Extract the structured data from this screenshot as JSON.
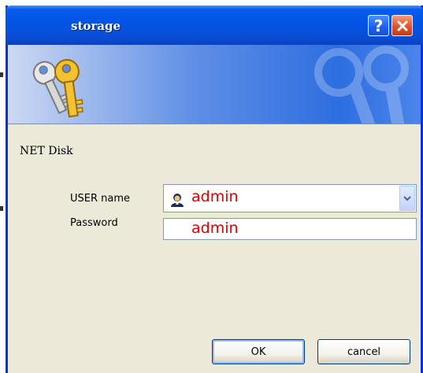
{
  "window": {
    "title": "storage",
    "help_glyph": "?",
    "close_glyph": "×"
  },
  "banner": {
    "icon": "keys-icon",
    "watermark": "keys-watermark"
  },
  "form": {
    "heading": "NET Disk",
    "user_label": "USER name",
    "user_value": "admin",
    "password_label": "Password",
    "password_value": "admin"
  },
  "buttons": {
    "ok_label": "OK",
    "cancel_label": "cancel"
  },
  "colors": {
    "titlebar": "#0054e3",
    "field_value": "#e00000",
    "dialog_bg": "#ece9d8"
  }
}
